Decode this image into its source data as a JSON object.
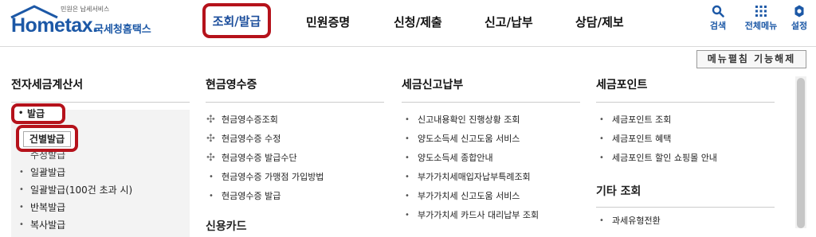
{
  "logo": {
    "main": "Hometax.",
    "korean": "국세청홈택스",
    "sub": "민원은 납세서비스"
  },
  "gnb": {
    "items": [
      {
        "label": "조회/발급",
        "active": true
      },
      {
        "label": "민원증명"
      },
      {
        "label": "신청/제출"
      },
      {
        "label": "신고/납부"
      },
      {
        "label": "상담/제보"
      }
    ]
  },
  "util": {
    "search": "검색",
    "all_menu": "전체메뉴",
    "settings": "설정"
  },
  "toolbar": {
    "menu_fix_off": "메뉴펼침 기능해제"
  },
  "columns": {
    "c1": {
      "title": "전자세금계산서",
      "issue": "발급",
      "individual_issue": "건별발급",
      "items": [
        "일괄발급",
        "일괄발급(100건 초과 시)",
        "반복발급"
      ],
      "clipped_top": "수정발급",
      "clipped_bottom": "복사발급"
    },
    "c2": {
      "title": "현금영수증",
      "items": [
        "현금영수증조회",
        "현금영수증 수정",
        "현금영수증 발급수단",
        "현금영수증 가맹점 가입방법",
        "현금영수증 발급"
      ],
      "next_title": "신용카드"
    },
    "c3": {
      "title": "세금신고납부",
      "items": [
        "신고내용확인 진행상황 조회",
        "양도소득세 신고도움 서비스",
        "양도소득세 종합안내",
        "부가가치세매입자납부특례조회",
        "부가가치세 신고도움 서비스",
        "부가가치세 카드사 대리납부 조회"
      ]
    },
    "c4": {
      "title": "세금포인트",
      "items": [
        "세금포인트 조회",
        "세금포인트 혜택",
        "세금포인트 할인 쇼핑몰 안내"
      ],
      "title2": "기타 조회",
      "items2": [
        "과세유형전환"
      ]
    }
  }
}
